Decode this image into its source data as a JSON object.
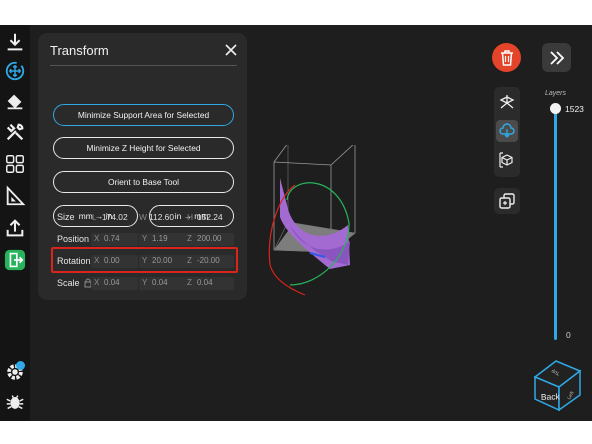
{
  "transform_panel": {
    "title": "Transform",
    "buttons": {
      "minimize_support": "Minimize Support Area for Selected",
      "minimize_z": "Minimize Z Height for Selected",
      "orient_base": "Orient to Base Tool",
      "mm_to_in": "mm → in",
      "in_to_mm": "in → mm"
    },
    "size": {
      "label": "Size",
      "x_axis": "L",
      "x": "174.02",
      "y_axis": "W",
      "y": "112.60",
      "z_axis": "H",
      "z": "152.24"
    },
    "position": {
      "label": "Position",
      "x": "0.74",
      "y": "1.19",
      "z": "200.00"
    },
    "rotation": {
      "label": "Rotation",
      "x": "0.00",
      "y": "20.00",
      "z": "-20.00"
    },
    "scale": {
      "label": "Scale",
      "x": "0.04",
      "y": "0.04",
      "z": "0.04"
    },
    "axes": {
      "x": "X",
      "y": "Y",
      "z": "Z"
    }
  },
  "layers": {
    "label": "Layers",
    "max": "1523",
    "min": "0",
    "fraction": 1.0
  },
  "viewcube": {
    "front": "Back",
    "top": "Top",
    "side": "Left"
  },
  "colors": {
    "accent": "#2fa9e6",
    "delete": "#e4442a",
    "highlight": "#d9251c",
    "model": "#a36bd1",
    "app_bg": "#1e1e1e"
  },
  "icons": [
    "download-icon",
    "move-icon",
    "paint-bucket-icon",
    "tools-icon",
    "grid-icon",
    "ruler-icon",
    "upload-icon",
    "exit-icon",
    "gear-icon",
    "bug-icon",
    "trash-icon",
    "double-chevron-icon",
    "axes-view-icon",
    "cloud-view-icon",
    "cube-view-icon",
    "duplicate-icon"
  ]
}
